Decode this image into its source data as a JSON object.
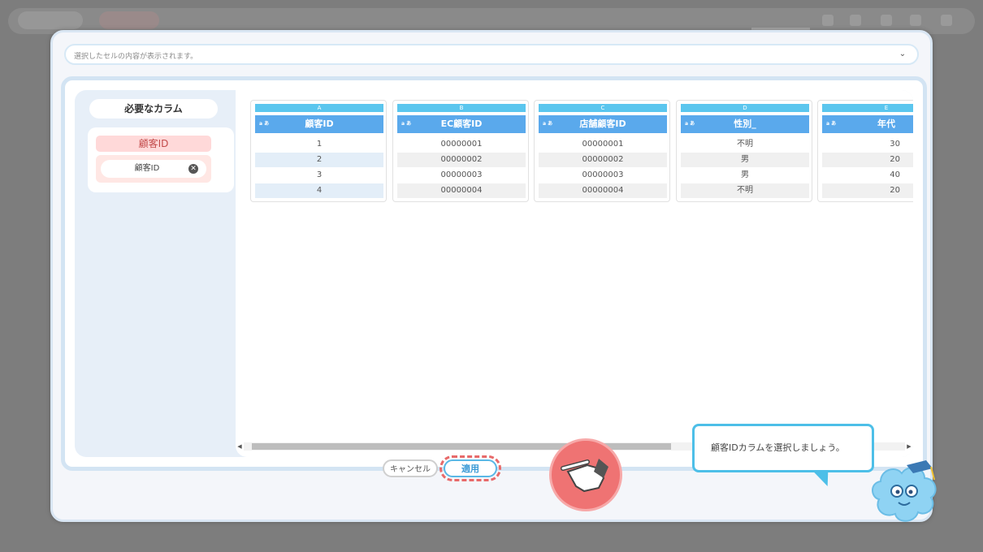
{
  "cell_bar": {
    "placeholder": "選択したセルの内容が表示されます。",
    "chevron_icon": "chevron-down-icon"
  },
  "required": {
    "title": "必要なカラム",
    "label": "顧客ID",
    "chip": "顧客ID",
    "remove_icon": "close-circle-icon"
  },
  "columns": [
    {
      "letter": "A",
      "type": "a あ",
      "name": "顧客ID",
      "rows": [
        "1",
        "2",
        "3",
        "4"
      ]
    },
    {
      "letter": "B",
      "type": "a あ",
      "name": "EC顧客ID",
      "rows": [
        "00000001",
        "00000002",
        "00000003",
        "00000004"
      ]
    },
    {
      "letter": "C",
      "type": "a あ",
      "name": "店舗顧客ID",
      "rows": [
        "00000001",
        "00000002",
        "00000003",
        "00000004"
      ]
    },
    {
      "letter": "D",
      "type": "a あ",
      "name": "性別_",
      "rows": [
        "不明",
        "男",
        "男",
        "不明"
      ]
    },
    {
      "letter": "E",
      "type": "a あ",
      "name": "年代",
      "rows": [
        "30",
        "20",
        "40",
        "20"
      ]
    }
  ],
  "footer": {
    "cancel": "キャンセル",
    "apply": "適用"
  },
  "tooltip": {
    "text": "顧客IDカラムを選択しましょう。"
  },
  "colors": {
    "accent": "#5aa9ec",
    "letter": "#5bc6ee",
    "highlight": "#e86a6a"
  }
}
